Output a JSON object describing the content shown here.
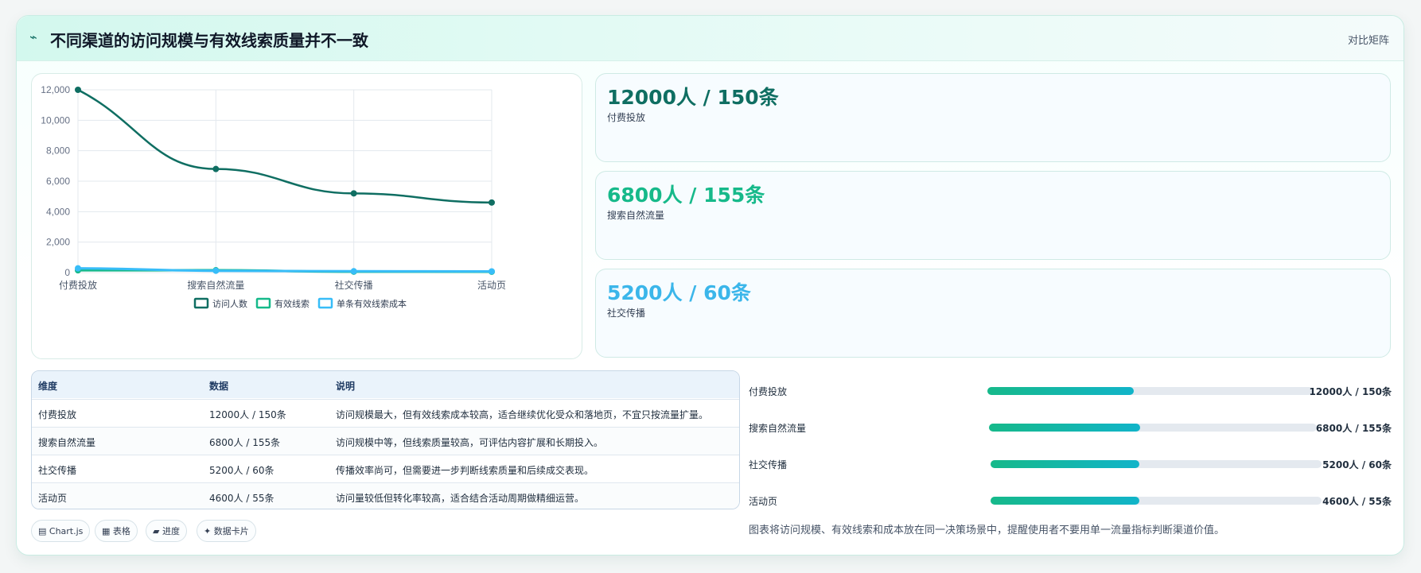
{
  "header": {
    "icon": "wave-icon",
    "title": "不同渠道的访问规模与有效线索质量并不一致",
    "tag": "对比矩阵"
  },
  "chart_data": {
    "type": "line",
    "categories": [
      "付费投放",
      "搜索自然流量",
      "社交传播",
      "活动页"
    ],
    "series": [
      {
        "name": "访问人数",
        "values": [
          12000,
          6800,
          5200,
          4600
        ],
        "color": "#0f6e62"
      },
      {
        "name": "有效线索",
        "values": [
          150,
          155,
          60,
          55
        ],
        "color": "#16b98a"
      },
      {
        "name": "单条有效线索成本",
        "values": [
          280,
          120,
          90,
          80
        ],
        "color": "#38bdf8"
      }
    ],
    "ylim": [
      0,
      12000
    ],
    "yticks": [
      "0",
      "2,000",
      "4,000",
      "6,000",
      "8,000",
      "10,000",
      "12,000"
    ],
    "grid": true,
    "legend": "bottom"
  },
  "kpis": [
    {
      "value": "12000人 / 150条",
      "label": "付费投放",
      "color": "#0f6e62"
    },
    {
      "value": "6800人 / 155条",
      "label": "搜索自然流量",
      "color": "#16b98a"
    },
    {
      "value": "5200人 / 60条",
      "label": "社交传播",
      "color": "#3bb6ea"
    }
  ],
  "table": {
    "headers": [
      "维度",
      "数据",
      "说明"
    ],
    "rows": [
      [
        "付费投放",
        "12000人 / 150条",
        "访问规模最大，但有效线索成本较高，适合继续优化受众和落地页，不宜只按流量扩量。"
      ],
      [
        "搜索自然流量",
        "6800人 / 155条",
        "访问规模中等，但线索质量较高，可评估内容扩展和长期投入。"
      ],
      [
        "社交传播",
        "5200人 / 60条",
        "传播效率尚可，但需要进一步判断线索质量和后续成交表现。"
      ],
      [
        "活动页",
        "4600人 / 55条",
        "访问量较低但转化率较高，适合结合活动周期做精细运营。"
      ]
    ]
  },
  "chips": [
    "▤ Chart.js",
    "▦ 表格",
    "▰ 进度",
    "✦ 数据卡片"
  ],
  "progress": [
    {
      "name": "付费投放",
      "value": "12000人 / 150条",
      "fraction": 0.45
    },
    {
      "name": "搜索自然流量",
      "value": "6800人 / 155条",
      "fraction": 0.46
    },
    {
      "name": "社交传播",
      "value": "5200人 / 60条",
      "fraction": 0.45
    },
    {
      "name": "活动页",
      "value": "4600人 / 55条",
      "fraction": 0.45
    }
  ],
  "note": "图表将访问规模、有效线索和成本放在同一决策场景中，提醒使用者不要用单一流量指标判断渠道价值。"
}
